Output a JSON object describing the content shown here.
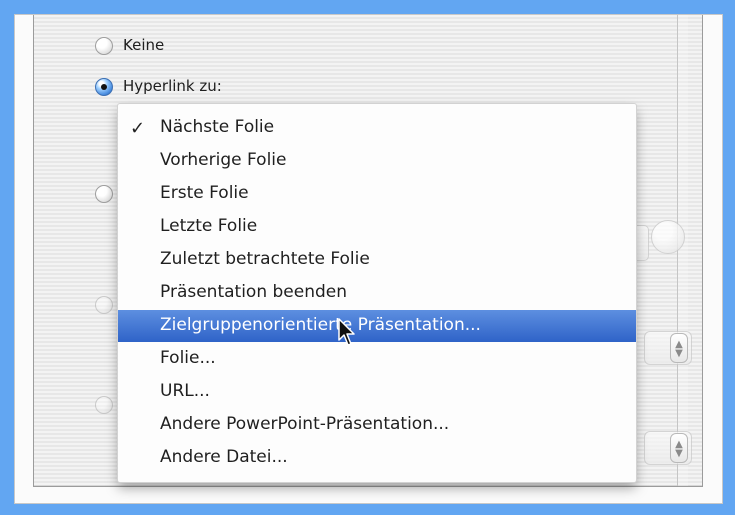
{
  "options": {
    "none_label": "Keine",
    "hyperlink_label": "Hyperlink zu:"
  },
  "menu": {
    "items": [
      "Nächste Folie",
      "Vorherige Folie",
      "Erste Folie",
      "Letzte Folie",
      "Zuletzt betrachtete Folie",
      "Präsentation beenden",
      "Zielgruppenorientierte Präsentation...",
      "Folie...",
      "URL...",
      "Andere PowerPoint-Präsentation...",
      "Andere Datei..."
    ],
    "checked_item": "Nächste Folie",
    "highlighted_item": "Zielgruppenorientierte Präsentation..."
  },
  "icons": {
    "check": "checkmark-icon",
    "cursor": "arrow-cursor-icon",
    "popup": "popup-arrows-icon"
  },
  "colors": {
    "background": "#62a6f2",
    "selection": "#2f63c8",
    "selection_light": "#5d8fe0"
  }
}
